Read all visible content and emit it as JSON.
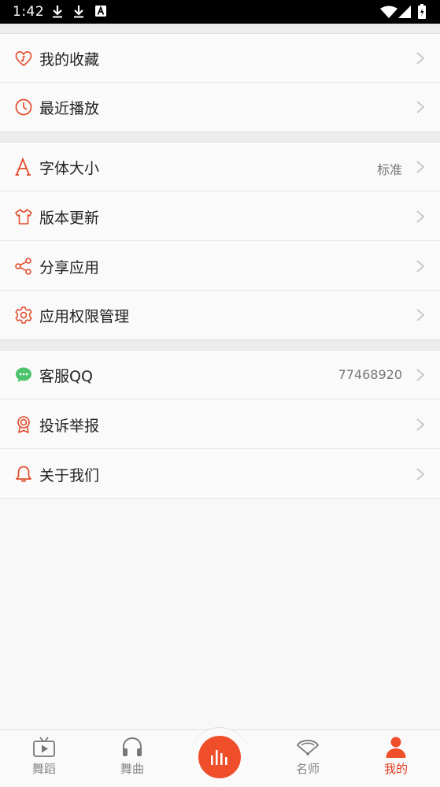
{
  "status_bar": {
    "time": "1:42",
    "left_icons": [
      "download-icon",
      "download-icon",
      "a-badge-icon"
    ],
    "right_icons": [
      "wifi-icon",
      "signal-icon",
      "battery-icon"
    ]
  },
  "menu": {
    "groups": [
      {
        "items": [
          {
            "label": "我的收藏",
            "icon": "heart-music-icon",
            "value": ""
          },
          {
            "label": "最近播放",
            "icon": "clock-icon",
            "value": ""
          }
        ]
      },
      {
        "items": [
          {
            "label": "字体大小",
            "icon": "font-icon",
            "value": "标准"
          },
          {
            "label": "版本更新",
            "icon": "shirt-icon",
            "value": ""
          },
          {
            "label": "分享应用",
            "icon": "share-icon",
            "value": ""
          },
          {
            "label": "应用权限管理",
            "icon": "gear-icon",
            "value": ""
          }
        ]
      },
      {
        "items": [
          {
            "label": "客服QQ",
            "icon": "chat-icon",
            "value": "77468920"
          },
          {
            "label": "投诉举报",
            "icon": "award-icon",
            "value": ""
          },
          {
            "label": "关于我们",
            "icon": "bell-icon",
            "value": ""
          }
        ]
      }
    ]
  },
  "tab_bar": {
    "tabs": [
      {
        "label": "舞蹈",
        "icon": "tv-play-icon",
        "active": false
      },
      {
        "label": "舞曲",
        "icon": "headphones-icon",
        "active": false
      },
      {
        "label": "",
        "icon": "sound-bars-icon",
        "active": false
      },
      {
        "label": "名师",
        "icon": "fan-icon",
        "active": false
      },
      {
        "label": "我的",
        "icon": "person-icon",
        "active": true
      }
    ]
  },
  "colors": {
    "accent": "#f04e2a",
    "active_tab": "#e03a1e",
    "chat_green": "#4cc36a",
    "status_bar": "#000000"
  }
}
